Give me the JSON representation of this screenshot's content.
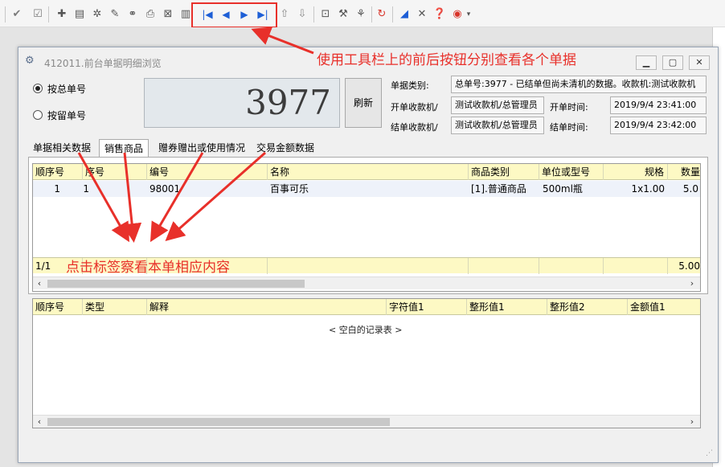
{
  "toolbar": {
    "icons": [
      "check-icon",
      "checkbox-icon",
      "add-icon",
      "insert-row-icon",
      "settings-icon",
      "edit-icon",
      "binoculars-icon",
      "print-icon",
      "export-icon",
      "barcode-icon"
    ],
    "nav": {
      "first": "|◀",
      "prev": "◀",
      "next": "▶",
      "last": "▶|"
    },
    "icons_right": [
      "arrow-up-icon",
      "arrow-down-icon",
      "preview-icon",
      "tool-icon",
      "magic-icon",
      "refresh-icon",
      "chart-icon",
      "tools-icon",
      "help-icon",
      "stop-icon",
      "dropdown-icon"
    ]
  },
  "window": {
    "title": "412011.前台单据明细浏览",
    "btn_min": "▁",
    "btn_max": "▢",
    "btn_close": "✕"
  },
  "mode": {
    "option1": "按总单号",
    "option2": "按留单号",
    "selected": "option1"
  },
  "display": {
    "number": "3977",
    "refresh": "刷新"
  },
  "info": {
    "doc_type_label": "单据类别:",
    "doc_type_value": "总单号:3977 - 已结单但尚未清机的数据。收款机:测试收款机",
    "open_machine_label": "开单收款机/",
    "open_machine_value": "测试收款机/总管理员",
    "open_time_label": "开单时间:",
    "open_time_value": "2019/9/4 23:41:00",
    "close_machine_label": "结单收款机/",
    "close_machine_value": "测试收款机/总管理员",
    "close_time_label": "结单时间:",
    "close_time_value": "2019/9/4 23:42:00"
  },
  "tabs": [
    "单据相关数据",
    "销售商品",
    "赠券赠出或使用情况",
    "交易金额数据"
  ],
  "active_tab": "销售商品",
  "grid1": {
    "columns": [
      "顺序号",
      "序号",
      "编号",
      "名称",
      "商品类别",
      "单位或型号",
      "规格",
      "数量"
    ],
    "rows": [
      [
        "1",
        "1",
        "98001",
        "百事可乐",
        "[1].普通商品",
        "500ml瓶",
        "1x1.00",
        "5.0"
      ]
    ],
    "footer_count": "1/1",
    "footer_total": "5.00"
  },
  "grid2": {
    "columns": [
      "顺序号",
      "类型",
      "解释",
      "字符值1",
      "整形值1",
      "整形值2",
      "金额值1"
    ],
    "empty_text": "< 空白的记录表 >"
  },
  "annotations": {
    "top": "使用工具栏上的前后按钮分别查看各个单据",
    "bottom": "点击标签察看本单相应内容"
  }
}
